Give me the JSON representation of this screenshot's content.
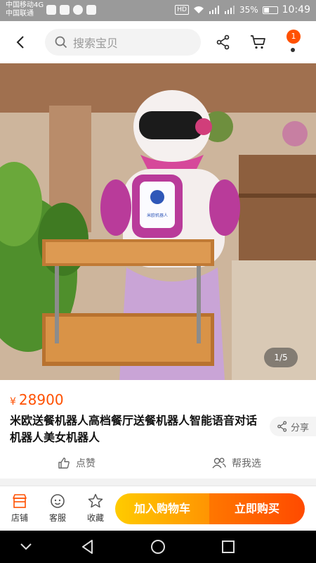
{
  "status_bar": {
    "carrier_1": "中国移动4G",
    "carrier_2": "中国联通",
    "hd": "HD",
    "battery": "35%",
    "time": "10:49"
  },
  "top_nav": {
    "search_placeholder": "搜索宝贝",
    "notification_count": "1"
  },
  "product": {
    "image_counter": "1/5",
    "currency": "¥",
    "price": "28900",
    "title": "米欧送餐机器人高档餐厅送餐机器人智能语音对话机器人美女机器人",
    "share_label": "分享",
    "like_label": "点赞",
    "help_choose_label": "帮我选",
    "robot_badge": "米欧机器人"
  },
  "bottom_bar": {
    "store_label": "店铺",
    "service_label": "客服",
    "favorite_label": "收藏",
    "add_cart_label": "加入购物车",
    "buy_now_label": "立即购买"
  },
  "colors": {
    "accent": "#ff5000",
    "cart_button": "#ffa800",
    "buy_button": "#ff5a00"
  },
  "icons": [
    "back-arrow-icon",
    "search-icon",
    "share-icon",
    "cart-icon",
    "more-icon",
    "like-icon",
    "group-icon",
    "store-icon",
    "service-icon",
    "star-icon",
    "nav-back-icon",
    "nav-home-icon",
    "nav-recent-icon"
  ]
}
